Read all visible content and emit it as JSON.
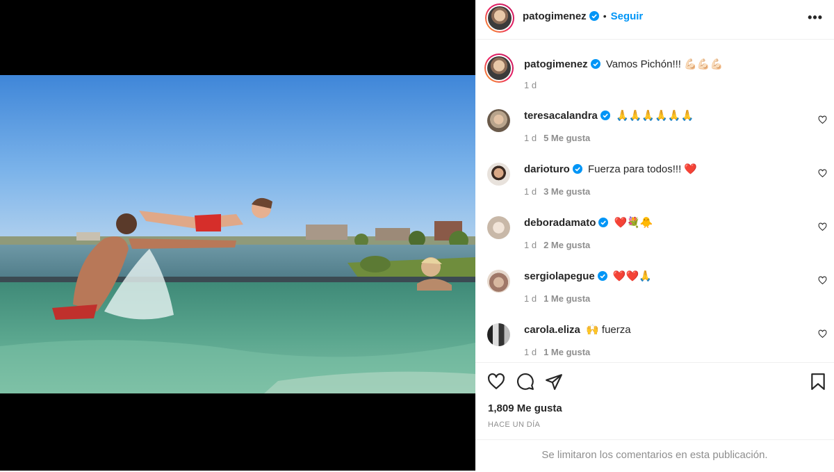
{
  "post": {
    "author": "patogimenez",
    "follow_label": "Seguir",
    "separator": "•",
    "more_label": "•••",
    "caption": "Vamos Pichón!!! 💪🏻💪🏻💪🏻",
    "caption_time": "1 d"
  },
  "comments": [
    {
      "user": "teresacalandra",
      "verified": true,
      "text": "🙏🙏🙏🙏🙏🙏",
      "time": "1 d",
      "likes": "5 Me gusta"
    },
    {
      "user": "darioturo",
      "verified": true,
      "text": "Fuerza para todos!!! ❤️",
      "time": "1 d",
      "likes": "3 Me gusta"
    },
    {
      "user": "deboradamato",
      "verified": true,
      "text": "❤️💐🐥",
      "time": "1 d",
      "likes": "2 Me gusta"
    },
    {
      "user": "sergiolapegue",
      "verified": true,
      "text": "❤️❤️🙏",
      "time": "1 d",
      "likes": "1 Me gusta"
    },
    {
      "user": "carola.eliza",
      "verified": false,
      "text": "🙌 fuerza",
      "time": "1 d",
      "likes": "1 Me gusta"
    }
  ],
  "footer": {
    "likes_count": "1,809 Me gusta",
    "posted_ago": "HACE UN DÍA",
    "comments_limited": "Se limitaron los comentarios en esta publicación."
  },
  "icons": [
    "more-icon",
    "verified-icon",
    "heart-icon",
    "comment-icon",
    "share-icon",
    "bookmark-icon"
  ],
  "colors": {
    "accent": "#0095f6",
    "verified": "#0095f6",
    "secondary_text": "#8e8e8e"
  }
}
